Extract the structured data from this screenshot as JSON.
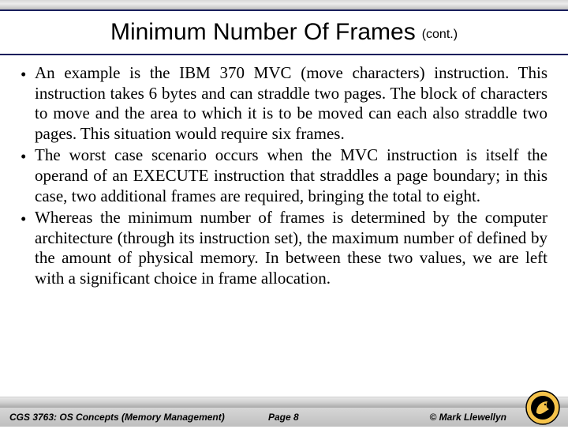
{
  "header": {
    "title": "Minimum Number Of Frames",
    "cont": "(cont.)"
  },
  "bullets": [
    "An example is the IBM 370 MVC (move characters) instruction. This instruction takes 6 bytes and can straddle two pages. The block of characters to move and the area to which it is to be moved can each also straddle two pages. This situation would require six frames.",
    "The worst case scenario occurs when the MVC instruction is itself the operand of an EXECUTE instruction that straddles a page boundary; in this case, two additional frames are required, bringing the total to eight.",
    "Whereas the minimum number of frames is determined by the computer architecture (through its instruction set), the maximum number of defined by the amount of physical memory. In between these two values, we are left with a significant choice in frame allocation."
  ],
  "footer": {
    "course": "CGS 3763: OS Concepts (Memory Management)",
    "page": "Page 8",
    "copyright": "© Mark Llewellyn"
  }
}
